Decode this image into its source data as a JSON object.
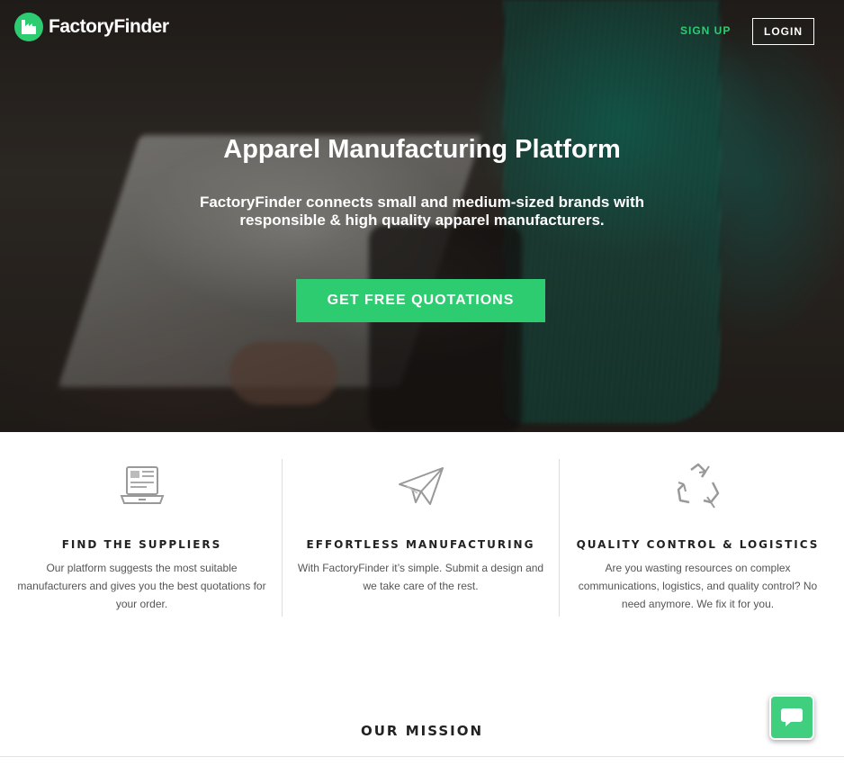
{
  "nav": {
    "brand": "FactoryFinder",
    "signup_label": "SIGN UP",
    "login_label": "LOGIN"
  },
  "hero": {
    "title": "Apparel Manufacturing Platform",
    "subtitle": "FactoryFinder connects small and medium-sized brands with responsible & high quality apparel manufacturers.",
    "cta_label": "GET FREE QUOTATIONS"
  },
  "features": [
    {
      "icon": "laptop-icon",
      "title": "FIND THE SUPPLIERS",
      "text": "Our platform suggests the most suitable manufacturers and gives you the best quotations for your order."
    },
    {
      "icon": "paper-plane-icon",
      "title": "EFFORTLESS MANUFACTURING",
      "text": "With FactoryFinder it’s simple. Submit a design and we take care of the rest."
    },
    {
      "icon": "recycle-icon",
      "title": "QUALITY CONTROL & LOGISTICS",
      "text": "Are you wasting resources on complex communications, logistics, and quality control? No need anymore. We fix it for you."
    }
  ],
  "mission": {
    "heading": "OUR MISSION"
  },
  "chat": {
    "icon": "chat-bubble-icon"
  },
  "colors": {
    "accent": "#2ecc71",
    "chat": "#3fcf7f"
  }
}
